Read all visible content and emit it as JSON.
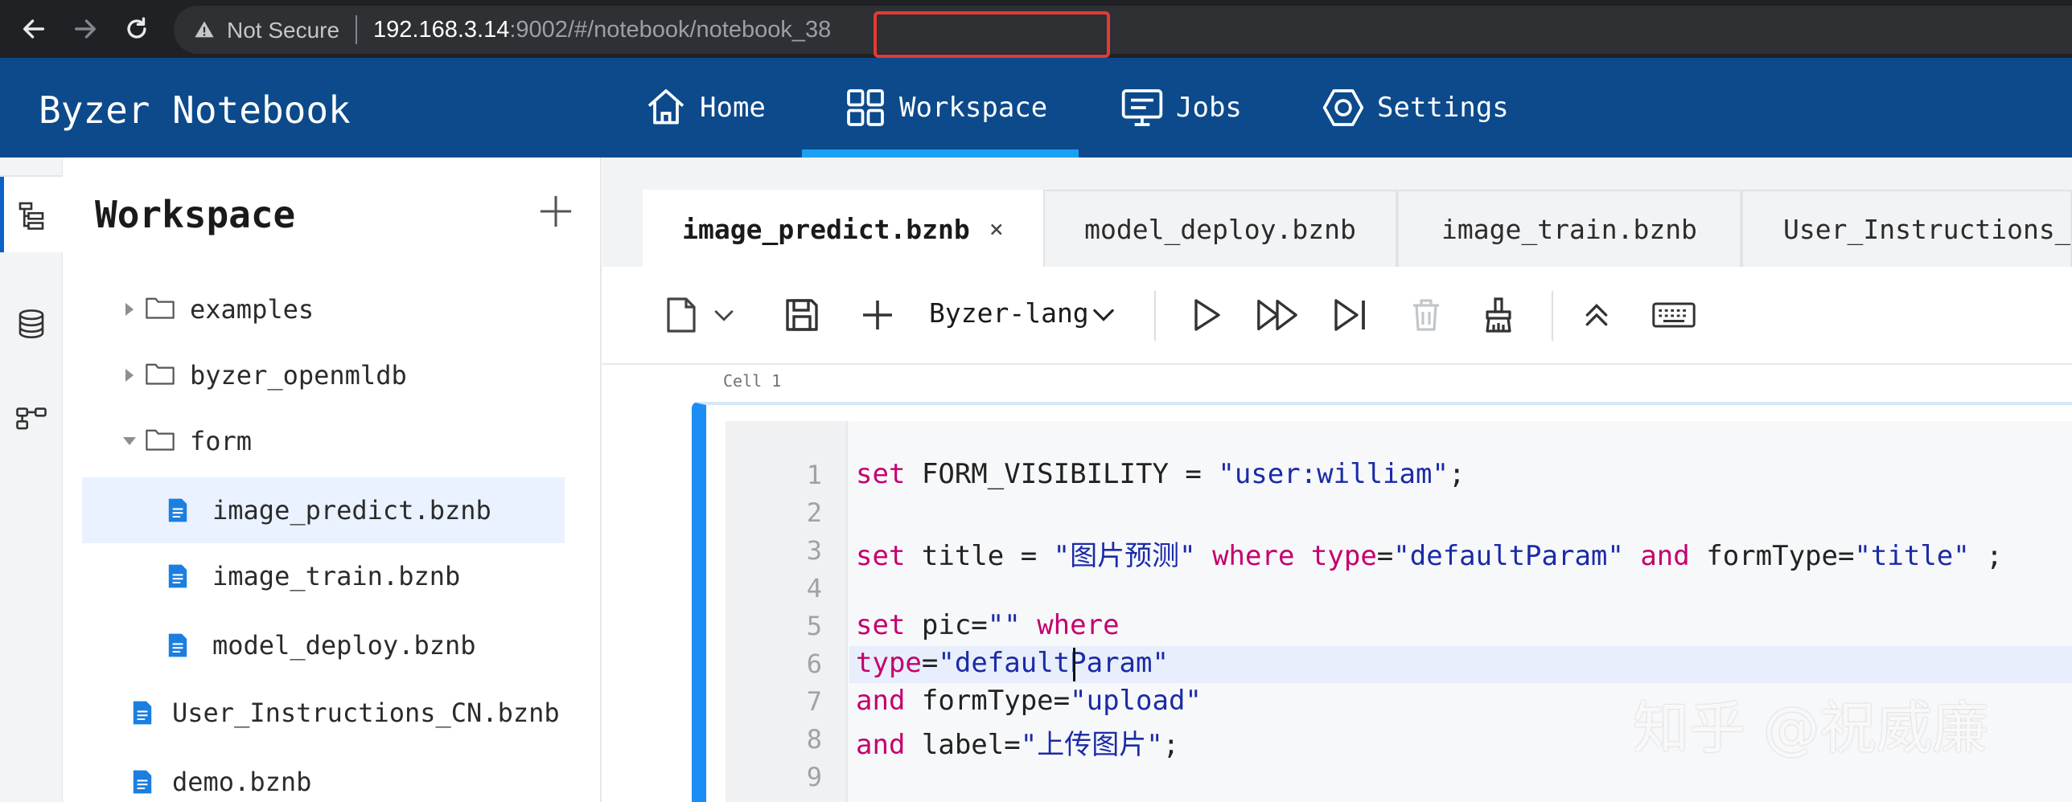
{
  "browser": {
    "not_secure": "Not Secure",
    "url_host": "192.168.3.14",
    "url_path": ":9002/#/notebook",
    "url_suffix": "/notebook_38"
  },
  "header": {
    "brand": "Byzer Notebook",
    "nav": [
      {
        "label": "Home",
        "icon": "home-icon"
      },
      {
        "label": "Workspace",
        "icon": "grid-icon"
      },
      {
        "label": "Jobs",
        "icon": "monitor-icon"
      },
      {
        "label": "Settings",
        "icon": "hexagon-gear-icon"
      }
    ],
    "active_nav": "Workspace",
    "accent": "#1aa1f5",
    "background": "#0c4a8c"
  },
  "rail": {
    "items": [
      {
        "icon": "tree-icon"
      },
      {
        "icon": "database-icon"
      },
      {
        "icon": "workflow-icon"
      }
    ]
  },
  "workspace": {
    "title": "Workspace",
    "items": [
      {
        "label": "examples",
        "type": "folder",
        "state": "collapsed"
      },
      {
        "label": "byzer_openmldb",
        "type": "folder",
        "state": "collapsed"
      },
      {
        "label": "form",
        "type": "folder",
        "state": "expanded"
      },
      {
        "label": "image_predict.bznb",
        "type": "file",
        "selected": true
      },
      {
        "label": "image_train.bznb",
        "type": "file"
      },
      {
        "label": "model_deploy.bznb",
        "type": "file"
      },
      {
        "label": "User_Instructions_CN.bznb",
        "type": "file"
      },
      {
        "label": "demo.bznb",
        "type": "file"
      }
    ]
  },
  "tabs": [
    {
      "label": "image_predict.bznb",
      "active": true,
      "close": "×"
    },
    {
      "label": "model_deploy.bznb"
    },
    {
      "label": "image_train.bznb"
    },
    {
      "label": "User_Instructions_C"
    }
  ],
  "toolbar": {
    "language": "Byzer-lang"
  },
  "cell": {
    "label": "Cell 1",
    "accent": "#1a8ef5",
    "line_numbers": [
      "1",
      "2",
      "3",
      "4",
      "5",
      "6",
      "7",
      "8",
      "9"
    ],
    "code": {
      "l1": {
        "kw": "set",
        "a": " FORM_VISIBILITY = ",
        "s": "\"user:william\"",
        "b": ";"
      },
      "l3": {
        "kw1": "set",
        "a": " title = ",
        "s1": "\"图片预测\"",
        "kw2": " where ",
        "kw3": "type",
        "b": "=",
        "s2": "\"defaultParam\"",
        "kw4": " and ",
        "c": "formType=",
        "s3": "\"title\"",
        "d": " ;"
      },
      "l5": {
        "kw1": "set",
        "a": " pic=",
        "s": "\"\"",
        "kw2": " where"
      },
      "l6": {
        "kw": "type",
        "a": "=",
        "s": "\"defaultParam\""
      },
      "l7": {
        "kw": "and",
        "a": " formType=",
        "s": "\"upload\""
      },
      "l8": {
        "kw": "and",
        "a": " label=",
        "s": "\"上传图片\"",
        "b": ";"
      }
    }
  },
  "watermark": "知乎 @祝威廉"
}
